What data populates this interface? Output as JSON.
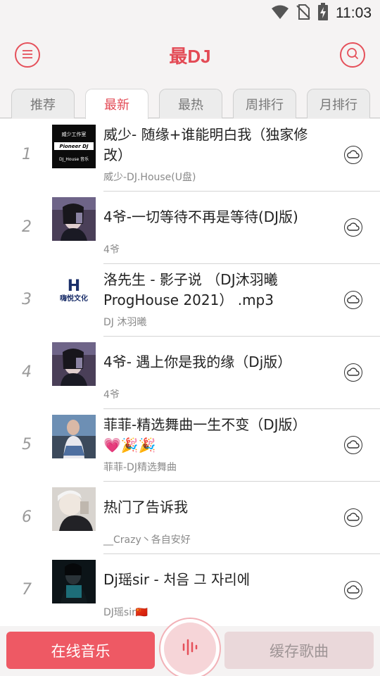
{
  "status": {
    "time": "11:03",
    "icons": [
      "wifi-icon",
      "no-sim-icon",
      "battery-charging-icon"
    ]
  },
  "header": {
    "title": "最DJ",
    "menu_icon": "menu-icon",
    "search_icon": "search-icon"
  },
  "tabs": [
    {
      "label": "推荐"
    },
    {
      "label": "最新",
      "active": true
    },
    {
      "label": "最热"
    },
    {
      "label": "周排行"
    },
    {
      "label": "月排行"
    }
  ],
  "songs": [
    {
      "rank": "1",
      "title": "威少- 随缘+谁能明白我（独家修改）",
      "artist": "威少-DJ.House(U盘)",
      "cover_text": [
        "威少工作室",
        "Pioneer DJ",
        "DJ_House 音乐"
      ]
    },
    {
      "rank": "2",
      "title": "4爷-一切等待不再是等待(DJ版)",
      "artist": "4爷"
    },
    {
      "rank": "3",
      "title": "洛先生 - 影子说 （DJ沐羽曦 ProgHouse 2021） .mp3",
      "artist": "DJ 沐羽曦",
      "cover_text": [
        "H",
        "嗨悦文化"
      ]
    },
    {
      "rank": "4",
      "title": "4爷- 遇上你是我的缘（Dj版）",
      "artist": "4爷"
    },
    {
      "rank": "5",
      "title": "菲菲-精选舞曲一生不变（DJ版）",
      "title_emoji": "💗🎉🎉",
      "artist": "菲菲-DJ精选舞曲"
    },
    {
      "rank": "6",
      "title": "热门了告诉我",
      "artist": "__Crazy丶各自安好"
    },
    {
      "rank": "7",
      "title": "Dj瑶sir - 처음 그 자리에",
      "artist": "DJ瑶sir",
      "artist_emoji": "🇨🇳"
    }
  ],
  "bottom": {
    "online_label": "在线音乐",
    "cache_label": "缓存歌曲",
    "center_icon": "sound-wave-icon"
  },
  "colors": {
    "accent": "#e34a55",
    "accent_button": "#ee5964",
    "cache_button": "#ead8da"
  }
}
